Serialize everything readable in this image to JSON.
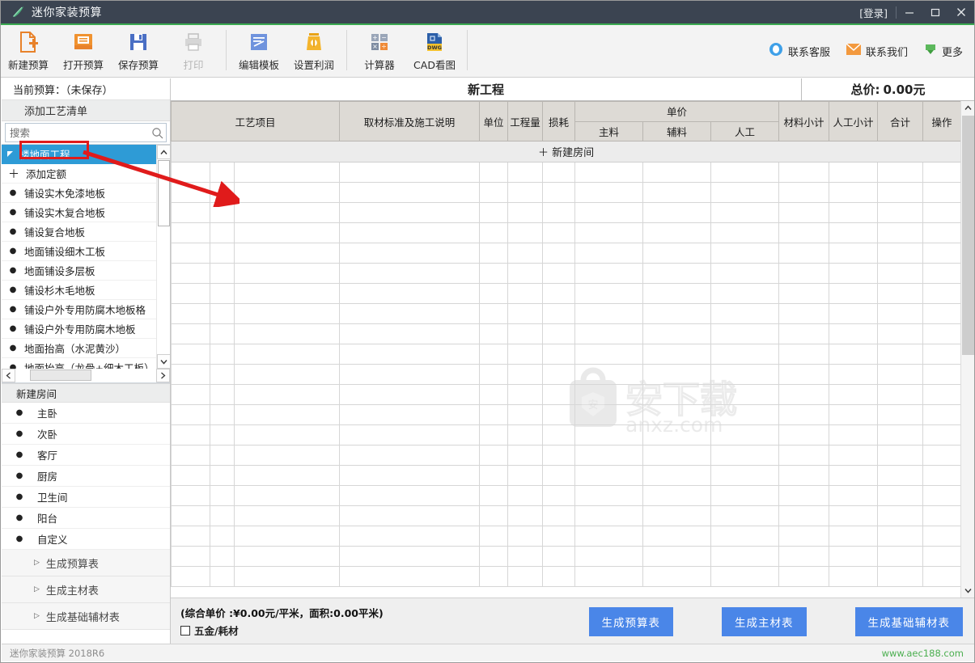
{
  "window": {
    "title": "迷你家装预算",
    "login_label": "[登录]",
    "minimize_icon": "minimize-icon",
    "maximize_icon": "maximize-icon",
    "close_icon": "close-icon",
    "accent_color": "#3aa94f",
    "titlebar_color": "#3b4451"
  },
  "toolbar": {
    "items": [
      {
        "label": "新建预算",
        "icon": "new-document-icon",
        "disabled": false
      },
      {
        "label": "打开预算",
        "icon": "open-folder-icon",
        "disabled": false
      },
      {
        "label": "保存预算",
        "icon": "save-floppy-icon",
        "disabled": false
      },
      {
        "label": "打印",
        "icon": "printer-icon",
        "disabled": true
      },
      {
        "label": "编辑模板",
        "icon": "edit-template-icon",
        "disabled": false
      },
      {
        "label": "设置利润",
        "icon": "profit-bag-icon",
        "disabled": false
      },
      {
        "label": "计算器",
        "icon": "calculator-icon",
        "disabled": false
      },
      {
        "label": "CAD看图",
        "icon": "dwg-file-icon",
        "disabled": false
      }
    ],
    "right_items": [
      {
        "label": "联系客服",
        "icon": "qq-penguin-icon"
      },
      {
        "label": "联系我们",
        "icon": "envelope-icon"
      },
      {
        "label": "更多",
        "icon": "more-arrow-icon"
      }
    ]
  },
  "sidebar": {
    "current_budget_label": "当前预算：（未保存）",
    "add_list_header": "添加工艺清单",
    "search": {
      "placeholder": "搜索",
      "value": "",
      "icon": "search-icon"
    },
    "tree": {
      "root": {
        "label": "楼地面工程",
        "selected": true,
        "icon": "expand-triangle-icon"
      },
      "add_quota": {
        "label": "添加定额",
        "icon": "plus-icon"
      },
      "items": [
        "铺设实木免漆地板",
        "铺设实木复合地板",
        "铺设复合地板",
        "地面铺设细木工板",
        "地面铺设多层板",
        "铺设杉木毛地板",
        "铺设户外专用防腐木地板格",
        "铺设户外专用防腐木地板",
        "地面抬高（水泥黄沙）",
        "地面抬高（龙骨+细木工板）"
      ]
    },
    "rooms_header": "新建房间",
    "rooms": [
      "主卧",
      "次卧",
      "客厅",
      "厨房",
      "卫生间",
      "阳台",
      "自定义"
    ],
    "generate_items": [
      "生成预算表",
      "生成主材表",
      "生成基础辅材表"
    ]
  },
  "main": {
    "project_title": "新工程",
    "total_label": "总价:",
    "total_value": "0.00元",
    "new_room_row": "＋ 新建房间",
    "columns": {
      "craft_item": "工艺项目",
      "material_standard": "取材标准及施工说明",
      "unit": "单位",
      "quantity": "工程量",
      "loss": "损耗",
      "unit_price_group": "单价",
      "unit_price_main": "主料",
      "unit_price_aux": "辅料",
      "unit_price_labor": "人工",
      "material_subtotal": "材料小计",
      "labor_subtotal": "人工小计",
      "total": "合计",
      "action": "操作"
    },
    "empty_rows": 21
  },
  "bottom": {
    "combined_price_text": "(综合单价 :¥0.00元/平米，面积:0.00平米)",
    "checkbox_label": "五金/耗材",
    "checkbox_checked": false,
    "buttons": [
      "生成预算表",
      "生成主材表",
      "生成基础辅材表"
    ],
    "button_color": "#4a86e8"
  },
  "status": {
    "version": "迷你家装预算 2018R6",
    "website": "www.aec188.com",
    "website_color": "#4caf50"
  },
  "watermark": {
    "text": "anxz.com",
    "glyph": "安下载"
  },
  "annotation": {
    "color": "#e01b1b",
    "target": "楼地面工程"
  }
}
